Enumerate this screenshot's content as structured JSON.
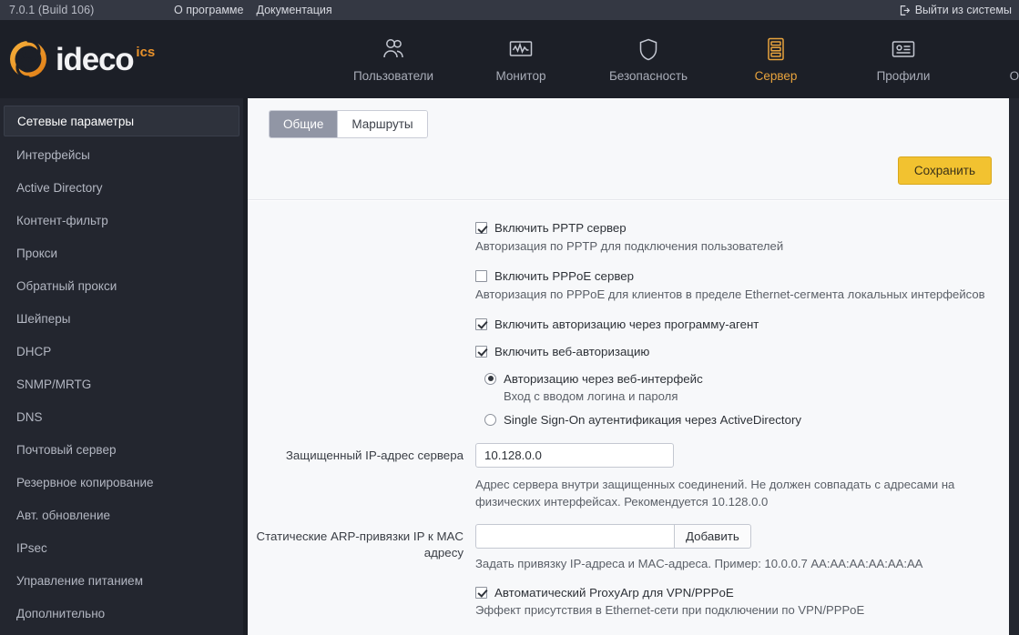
{
  "topbar": {
    "version": "7.0.1 (Build 106)",
    "about": "О программе",
    "docs": "Документация",
    "logout": "Выйти из системы"
  },
  "brand": {
    "name": "ideco",
    "suffix": "ics"
  },
  "mainnav": [
    {
      "label": "Пользователи",
      "icon": "users-icon",
      "active": false
    },
    {
      "label": "Монитор",
      "icon": "monitor-icon",
      "active": false
    },
    {
      "label": "Безопасность",
      "icon": "shield-icon",
      "active": false
    },
    {
      "label": "Сервер",
      "icon": "server-icon",
      "active": true
    },
    {
      "label": "Профили",
      "icon": "profile-card-icon",
      "active": false
    },
    {
      "label": "Отчеты",
      "icon": "clipboard-chart-icon",
      "active": false
    }
  ],
  "sidebar": {
    "items": [
      {
        "label": "Сетевые параметры",
        "active": true
      },
      {
        "label": "Интерфейсы",
        "active": false
      },
      {
        "label": "Active Directory",
        "active": false
      },
      {
        "label": "Контент-фильтр",
        "active": false
      },
      {
        "label": "Прокси",
        "active": false
      },
      {
        "label": "Обратный прокси",
        "active": false
      },
      {
        "label": "Шейперы",
        "active": false
      },
      {
        "label": "DHCP",
        "active": false
      },
      {
        "label": "SNMP/MRTG",
        "active": false
      },
      {
        "label": "DNS",
        "active": false
      },
      {
        "label": "Почтовый сервер",
        "active": false
      },
      {
        "label": "Резервное копирование",
        "active": false
      },
      {
        "label": "Авт. обновление",
        "active": false
      },
      {
        "label": "IPsec",
        "active": false
      },
      {
        "label": "Управление питанием",
        "active": false
      },
      {
        "label": "Дополнительно",
        "active": false
      }
    ]
  },
  "tabs": [
    {
      "label": "Общие",
      "active": true
    },
    {
      "label": "Маршруты",
      "active": false
    }
  ],
  "toolbar": {
    "save_label": "Сохранить"
  },
  "form": {
    "pptp": {
      "label": "Включить PPTP сервер",
      "checked": true,
      "hint": "Авторизация по PPTP для подключения пользователей"
    },
    "pppoe": {
      "label": "Включить PPPoE сервер",
      "checked": false,
      "hint": "Авторизация по PPPoE для клиентов в пределе Ethernet-сегмента локальных интерфейсов"
    },
    "agent_auth": {
      "label": "Включить авторизацию через программу-агент",
      "checked": true
    },
    "web_auth": {
      "label": "Включить веб-авторизацию",
      "checked": true
    },
    "auth_mode": {
      "options": [
        {
          "label": "Авторизацию через веб-интерфейс",
          "selected": true,
          "hint": "Вход с вводом логина и пароля"
        },
        {
          "label": "Single Sign-On аутентификация через ActiveDirectory",
          "selected": false,
          "hint": ""
        }
      ]
    },
    "protected_ip": {
      "label": "Защищенный IP-адрес сервера",
      "value": "10.128.0.0",
      "placeholder": "",
      "hint": "Адрес сервера внутри защищенных соединений. Не должен совпадать с адресами на физических интерфейсах. Рекомендуется 10.128.0.0"
    },
    "static_arp": {
      "label": "Статические ARP-привязки IP к MAC адресу",
      "value": "",
      "placeholder": "",
      "add_label": "Добавить",
      "hint": "Задать привязку IP-адреса и MAC-адреса. Пример: 10.0.0.7 AA:AA:AA:AA:AA:AA"
    },
    "proxy_arp": {
      "label": "Автоматический ProxyArp для VPN/PPPoE",
      "checked": true,
      "hint": "Эффект присутствия в Ethernet-сети при подключении по VPN/PPPoE"
    }
  },
  "colors": {
    "accent": "#e8a33d",
    "save_button": "#f2c230",
    "dark_bg": "#23262f",
    "header_bg": "#1c1f27",
    "content_bg": "#f7f8fa",
    "tab_active": "#9196a5"
  }
}
